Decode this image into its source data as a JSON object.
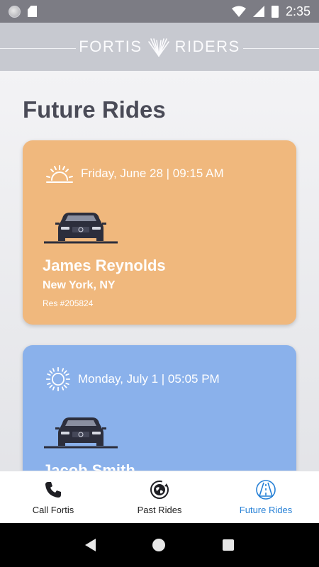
{
  "status_bar": {
    "time": "2:35",
    "icons": [
      "notification-dot-icon",
      "sd-card-icon",
      "wifi-icon",
      "signal-icon",
      "battery-icon"
    ]
  },
  "header": {
    "brand_left": "FORTIS",
    "brand_right": "RIDERS",
    "logo_icon": "wings-logo-icon"
  },
  "page": {
    "title": "Future Rides"
  },
  "rides": [
    {
      "time_icon": "sunrise-icon",
      "datetime": "Friday, June 28 | 09:15 AM",
      "car_icon": "car-front-icon",
      "name": "James Reynolds",
      "location": "New York, NY",
      "reservation": "Res #205824",
      "color": "#f0b87d"
    },
    {
      "time_icon": "sun-icon",
      "datetime": "Monday, July 1 | 05:05 PM",
      "car_icon": "car-front-icon",
      "name": "Jacob Smith",
      "location": "",
      "reservation": "",
      "color": "#8ab1eb"
    }
  ],
  "bottom_nav": {
    "items": [
      {
        "label": "Call Fortis",
        "icon": "phone-icon",
        "active": false
      },
      {
        "label": "Past Rides",
        "icon": "globe-history-icon",
        "active": false
      },
      {
        "label": "Future Rides",
        "icon": "road-icon",
        "active": true
      }
    ],
    "active_color": "#2680d6"
  }
}
